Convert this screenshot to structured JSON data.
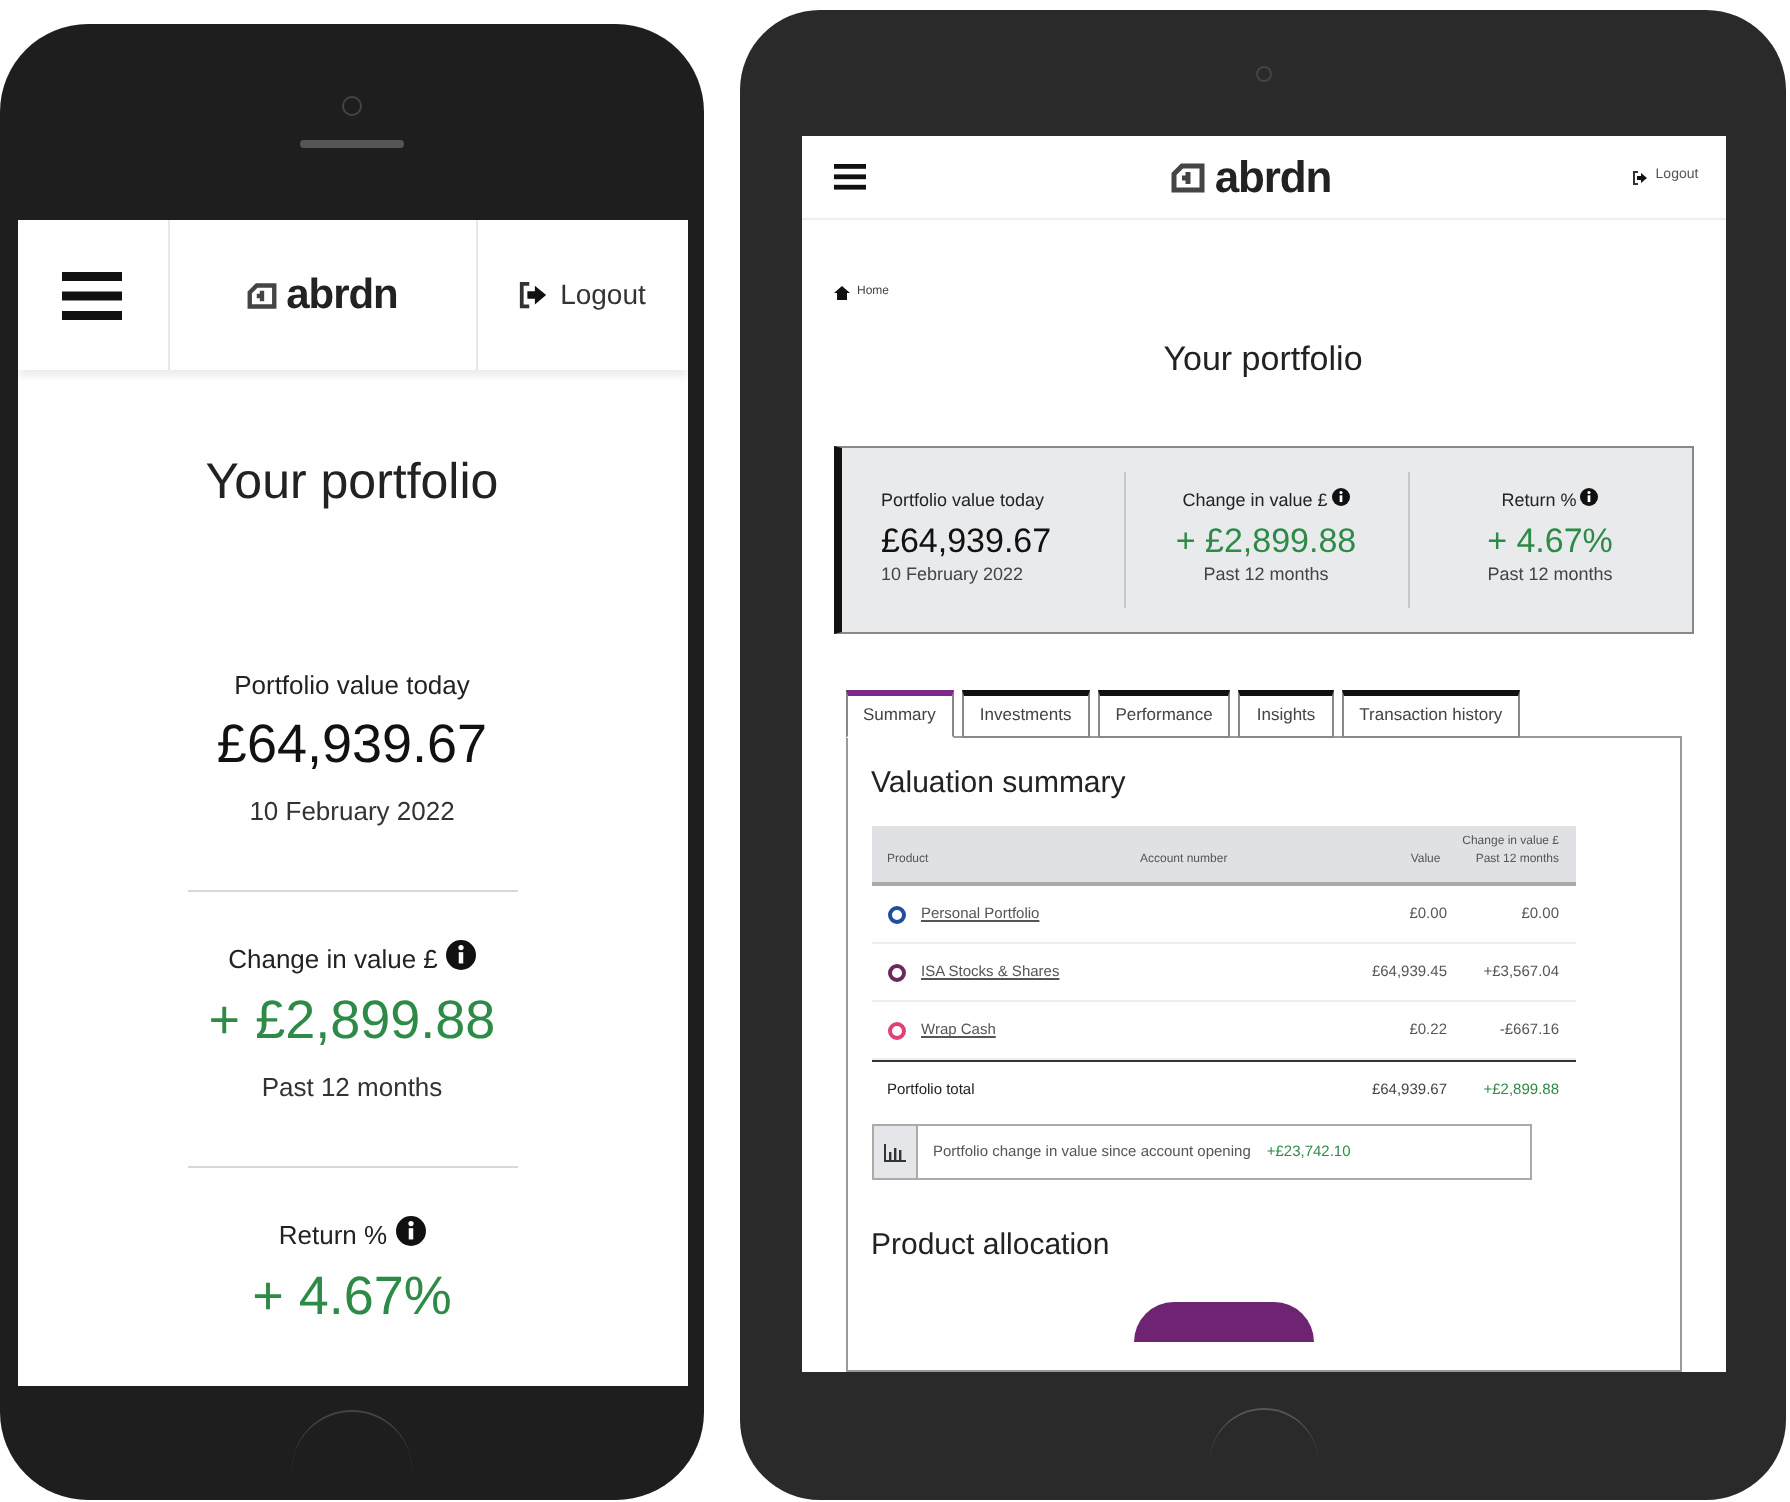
{
  "phone": {
    "header": {
      "logo": "abrdn",
      "logout": "Logout"
    },
    "title": "Your portfolio",
    "stats": [
      {
        "label": "Portfolio value today",
        "info": false,
        "value": "£64,939.67",
        "note": "10 February 2022",
        "positive": false
      },
      {
        "label": "Change in value £",
        "info": true,
        "value": "+ £2,899.88",
        "note": "Past 12 months",
        "positive": true
      },
      {
        "label": "Return %",
        "info": true,
        "value": "+ 4.67%",
        "positive": true
      }
    ]
  },
  "tablet": {
    "header": {
      "logo": "abrdn",
      "logout": "Logout"
    },
    "breadcrumb": "Home",
    "title": "Your portfolio",
    "stats": [
      {
        "label": "Portfolio value today",
        "info": false,
        "value": "£64,939.67",
        "note": "10 February 2022",
        "positive": false
      },
      {
        "label": "Change in value £",
        "info": true,
        "value": "+ £2,899.88",
        "note": "Past 12 months",
        "positive": true
      },
      {
        "label": "Return %",
        "info": true,
        "value": "+ 4.67%",
        "note": "Past 12 months",
        "positive": true
      }
    ],
    "tabs": [
      {
        "label": "Summary",
        "selected": true
      },
      {
        "label": "Investments",
        "selected": false
      },
      {
        "label": "Performance",
        "selected": false
      },
      {
        "label": "Insights",
        "selected": false
      },
      {
        "label": "Transaction history",
        "selected": false
      }
    ],
    "valuation": {
      "title": "Valuation summary",
      "columns": [
        "Product",
        "Account number",
        "Value",
        "Change in value £ Past 12 months"
      ],
      "rows": [
        {
          "name": "Personal Portfolio",
          "color": "#1f4e9c",
          "value": "£0.00",
          "change": "£0.00"
        },
        {
          "name": "ISA Stocks & Shares",
          "color": "#6b2a5e",
          "value": "£64,939.45",
          "change": "+£3,567.04"
        },
        {
          "name": "Wrap Cash",
          "color": "#e0407a",
          "value": "£0.22",
          "change": "-£667.16"
        }
      ],
      "total": {
        "label": "Portfolio total",
        "value": "£64,939.67",
        "change": "+£2,899.88"
      },
      "since_opening": {
        "label": "Portfolio change in value since account opening",
        "value": "+£23,742.10"
      }
    },
    "allocation": {
      "title": "Product allocation"
    }
  }
}
